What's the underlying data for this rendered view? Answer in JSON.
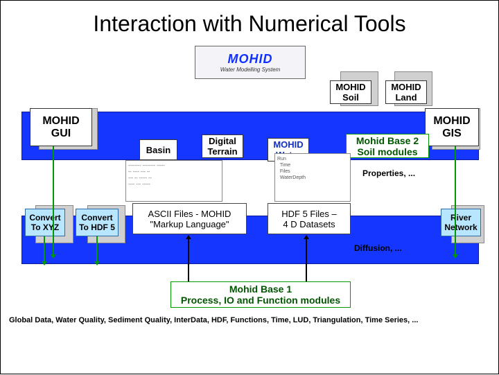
{
  "title": "Interaction with Numerical Tools",
  "logo": {
    "main": "MOHID",
    "sub": "Water Modelling System"
  },
  "modules": {
    "mohid_soil": "MOHID\nSoil",
    "mohid_land": "MOHID\nLand",
    "mohid_gui": "MOHID\nGUI",
    "mohid_gis": "MOHID\nGIS",
    "basin": "Basin",
    "digital_terrain": "Digital\nTerrain",
    "mohid_water": "MOHID\nWater",
    "convert_xyz": "Convert\nTo XYZ",
    "convert_hdf5": "Convert\nTo HDF 5",
    "river_network": "River\nNetwork"
  },
  "green_labels": {
    "base2": "Mohid Base 2\nSoil modules",
    "base1": "Mohid Base 1\nProcess, IO and Function modules",
    "props": "Properties, ...",
    "diff": "Diffusion, ..."
  },
  "file_formats": {
    "ascii": {
      "l1": "ASCII Files - MOHID",
      "l2": "\"Markup Language\""
    },
    "hdf": {
      "l1": "HDF 5 Files –",
      "l2": "4 D Datasets"
    }
  },
  "bottom_text": "Global Data, Water Quality, Sediment Quality, InterData, HDF, Functions, Time, LUD, Triangulation, Time Series, ...",
  "mock_text": "Run\n  Time\n  Files\n  WaterDepth"
}
